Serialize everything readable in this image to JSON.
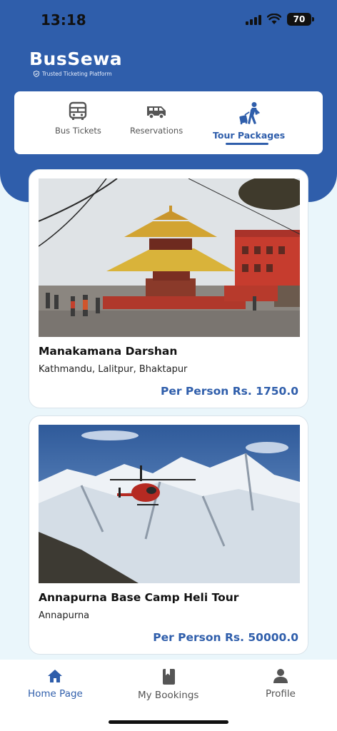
{
  "status_bar": {
    "time": "13:18",
    "battery": "70"
  },
  "brand": {
    "title": "BusSewa",
    "tagline": "Trusted Ticketing Platform"
  },
  "categories": [
    {
      "label": "Bus Tickets",
      "icon": "bus-icon",
      "active": false
    },
    {
      "label": "Reservations",
      "icon": "van-icon",
      "active": false
    },
    {
      "label": "Tour Packages",
      "icon": "traveler-icon",
      "active": true
    }
  ],
  "packages": [
    {
      "title": "Manakamana Darshan",
      "location": "Kathmandu, Lalitpur, Bhaktapur",
      "price": "Per Person Rs. 1750.0",
      "image": "temple-photo"
    },
    {
      "title": "Annapurna Base Camp Heli Tour",
      "location": "Annapurna",
      "price": "Per Person Rs. 50000.0",
      "image": "helicopter-mountain-photo"
    }
  ],
  "nav": [
    {
      "label": "Home Page",
      "icon": "home-icon",
      "active": true
    },
    {
      "label": "My Bookings",
      "icon": "book-icon",
      "active": false
    },
    {
      "label": "Profile",
      "icon": "person-icon",
      "active": false
    }
  ],
  "colors": {
    "primary": "#2f5eab",
    "background": "#eaf6fb"
  }
}
